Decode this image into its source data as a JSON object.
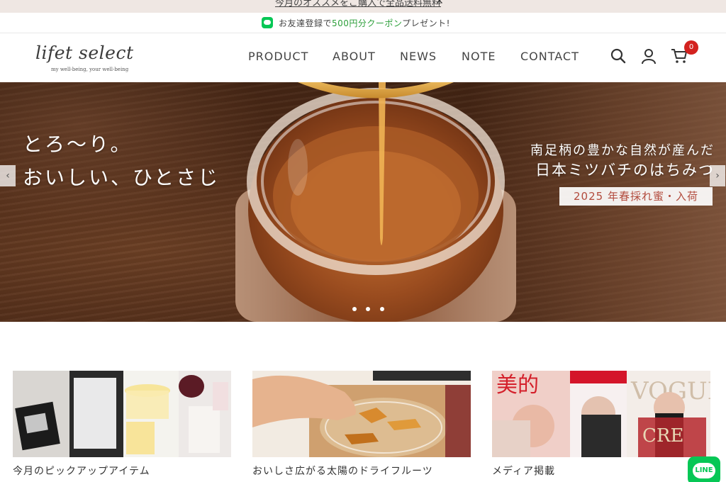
{
  "promo": {
    "text": "今月のオススメをご購入で全品送料無料",
    "close_icon": "close-icon"
  },
  "line_bar": {
    "text_before": "お友達登録で",
    "highlight": "500円分クーポン",
    "text_after": "プレゼント!"
  },
  "header": {
    "logo": {
      "name": "lifet select",
      "tagline": "my well-being, your well-being"
    },
    "nav": [
      "PRODUCT",
      "ABOUT",
      "NEWS",
      "NOTE",
      "CONTACT"
    ],
    "icons": [
      "search-icon",
      "user-icon",
      "cart-icon"
    ],
    "cart_count": "0"
  },
  "hero": {
    "left_line1": "とろ〜り。",
    "left_line2": "おいしい、ひとさじ",
    "right_line1": "南足柄の豊かな自然が産んだ",
    "right_line2": "日本ミツバチのはちみつ",
    "badge": "2025 年春採れ蜜・入荷",
    "prev_arrow": "‹",
    "next_arrow": "›",
    "slides": 3,
    "active_slide": 1
  },
  "cards": [
    {
      "title": "今月のピックアップアイテム"
    },
    {
      "title": "おいしさ広がる太陽のドライフルーツ"
    },
    {
      "title": "メディア掲載"
    }
  ],
  "line_float": {
    "label": "LINE"
  },
  "colors": {
    "line_green": "#06c755",
    "badge_red": "#d3221f",
    "hero_badge_text": "#b24a3c"
  }
}
